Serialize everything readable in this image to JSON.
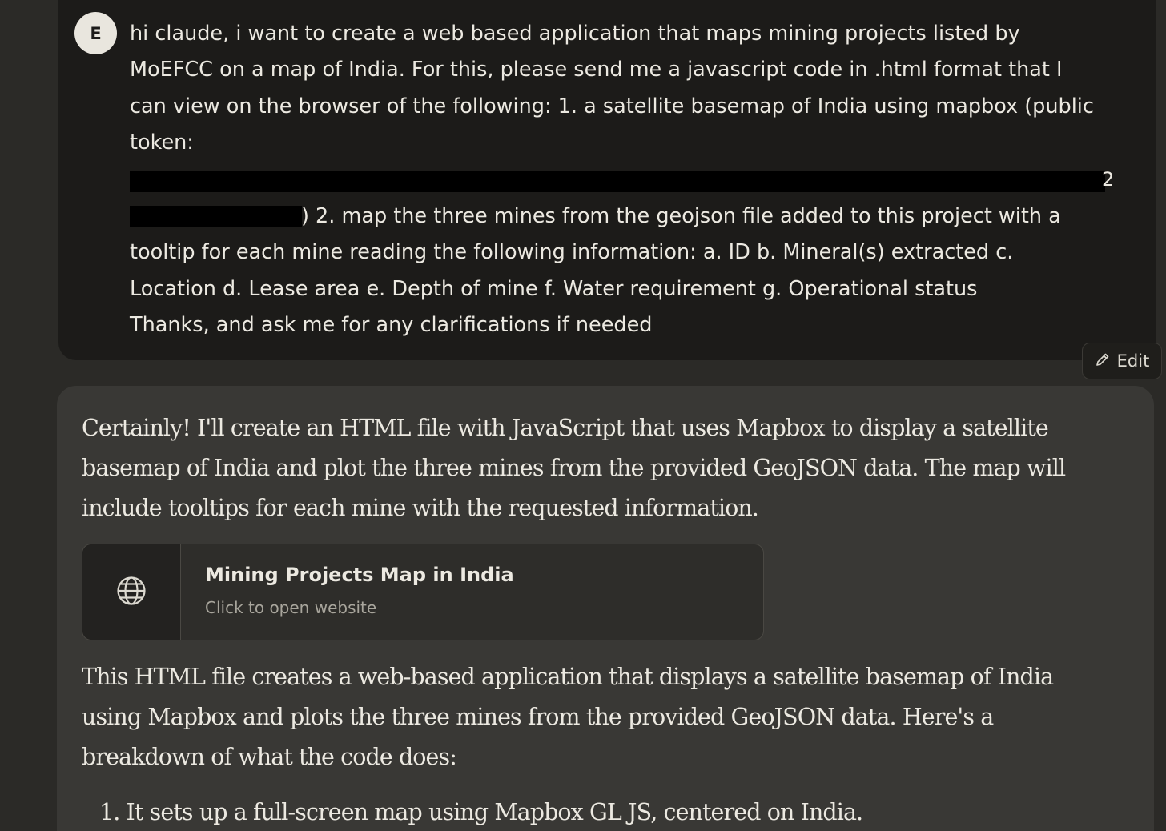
{
  "user_message": {
    "avatar_initial": "E",
    "lines": [
      "hi claude, i want to create a web based application that maps mining projects listed by",
      "MoEFCC on a map of India. For this, please send me a javascript code in .html format that I",
      "can view on the browser of the following: 1. a satellite basemap of India using mapbox (public",
      "token:",
      ") 2. map the three mines from the geojson file added to this project with a",
      "tooltip for each mine reading the following information: a. ID b. Mineral(s) extracted c.",
      "Location d. Lease area e. Depth of mine f. Water requirement g. Operational status",
      "Thanks, and ask me for any clarifications if needed"
    ],
    "edit_label": "Edit"
  },
  "assistant_message": {
    "intro_lines": [
      "Certainly! I'll create an HTML file with JavaScript that uses Mapbox to display a satellite",
      "basemap of India and plot the three mines from the provided GeoJSON data. The map will",
      "include tooltips for each mine with the requested information."
    ],
    "artifact": {
      "title": "Mining Projects Map in India",
      "subtitle": "Click to open website",
      "icon": "globe-icon"
    },
    "body_lines": [
      "This HTML file creates a web-based application that displays a satellite basemap of India",
      "using Mapbox and plots the three mines from the provided GeoJSON data. Here's a",
      "breakdown of what the code does:"
    ],
    "list_items": [
      "1. It sets up a full-screen map using Mapbox GL JS, centered on India."
    ]
  }
}
